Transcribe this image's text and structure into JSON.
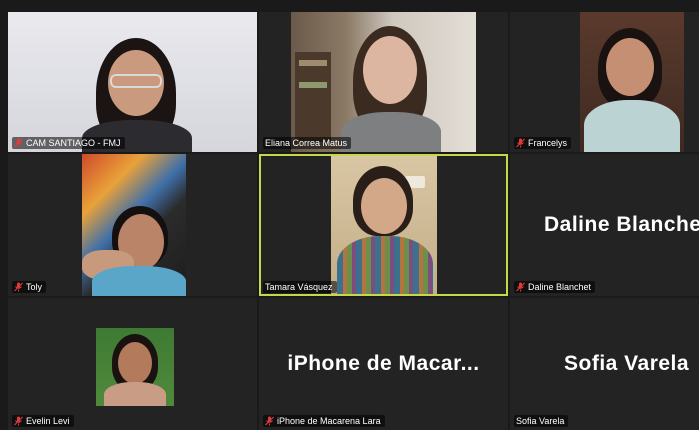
{
  "participants": [
    {
      "name": "CAM SANTIAGO - FMJ",
      "muted": true,
      "video": true
    },
    {
      "name": "Eliana Correa Matus",
      "muted": false,
      "video": true
    },
    {
      "name": "Francelys",
      "muted": true,
      "video": true
    },
    {
      "name": "Toly",
      "muted": true,
      "video": true
    },
    {
      "name": "Tamara Vásquez",
      "muted": false,
      "video": true,
      "active_speaker": true
    },
    {
      "name": "Daline Blanchet",
      "muted": true,
      "video": false,
      "display_name": "Daline Blanchet"
    },
    {
      "name": "Evelin Levi",
      "muted": true,
      "video": true
    },
    {
      "name": "iPhone de Macarena Lara",
      "muted": true,
      "video": false,
      "display_name": "iPhone de Macar..."
    },
    {
      "name": "Sofia Varela",
      "muted": false,
      "video": false,
      "display_name": "Sofia Varela"
    }
  ],
  "icons": {
    "muted_mic": "mic-muted-icon"
  },
  "colors": {
    "active_border": "#c6d84a",
    "muted_icon": "#e03a3a",
    "tile_bg": "#232323"
  }
}
